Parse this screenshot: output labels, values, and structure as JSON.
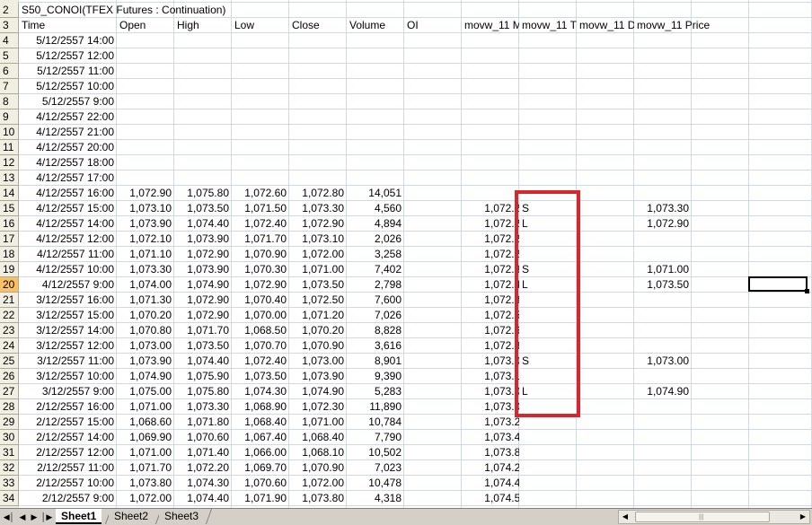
{
  "sheet": {
    "title_row_num": "2",
    "title": "S50_CONOI(TFEX Futures : Continuation)",
    "header_row_num": "3",
    "headers": [
      "Time",
      "Open",
      "High",
      "Low",
      "Close",
      "Volume",
      "OI",
      "movw_11 M",
      "movw_11 T",
      "movw_11 D",
      "movw_11 Price"
    ],
    "active_row": "20",
    "rows": [
      {
        "n": "4",
        "time": "5/12/2557 14:00",
        "open": "",
        "high": "",
        "low": "",
        "close": "",
        "volume": "",
        "mov": "",
        "sig": "",
        "price": ""
      },
      {
        "n": "5",
        "time": "5/12/2557 12:00",
        "open": "",
        "high": "",
        "low": "",
        "close": "",
        "volume": "",
        "mov": "",
        "sig": "",
        "price": ""
      },
      {
        "n": "6",
        "time": "5/12/2557 11:00",
        "open": "",
        "high": "",
        "low": "",
        "close": "",
        "volume": "",
        "mov": "",
        "sig": "",
        "price": ""
      },
      {
        "n": "7",
        "time": "5/12/2557 10:00",
        "open": "",
        "high": "",
        "low": "",
        "close": "",
        "volume": "",
        "mov": "",
        "sig": "",
        "price": ""
      },
      {
        "n": "8",
        "time": "5/12/2557 9:00",
        "open": "",
        "high": "",
        "low": "",
        "close": "",
        "volume": "",
        "mov": "",
        "sig": "",
        "price": ""
      },
      {
        "n": "9",
        "time": "4/12/2557 22:00",
        "open": "",
        "high": "",
        "low": "",
        "close": "",
        "volume": "",
        "mov": "",
        "sig": "",
        "price": ""
      },
      {
        "n": "10",
        "time": "4/12/2557 21:00",
        "open": "",
        "high": "",
        "low": "",
        "close": "",
        "volume": "",
        "mov": "",
        "sig": "",
        "price": ""
      },
      {
        "n": "11",
        "time": "4/12/2557 20:00",
        "open": "",
        "high": "",
        "low": "",
        "close": "",
        "volume": "",
        "mov": "",
        "sig": "",
        "price": ""
      },
      {
        "n": "12",
        "time": "4/12/2557 18:00",
        "open": "",
        "high": "",
        "low": "",
        "close": "",
        "volume": "",
        "mov": "",
        "sig": "",
        "price": ""
      },
      {
        "n": "13",
        "time": "4/12/2557 17:00",
        "open": "",
        "high": "",
        "low": "",
        "close": "",
        "volume": "",
        "mov": "",
        "sig": "",
        "price": ""
      },
      {
        "n": "14",
        "time": "4/12/2557 16:00",
        "open": "1,072.90",
        "high": "1,075.80",
        "low": "1,072.60",
        "close": "1,072.80",
        "volume": "14,051",
        "mov": "",
        "sig": "",
        "price": ""
      },
      {
        "n": "15",
        "time": "4/12/2557 15:00",
        "open": "1,073.10",
        "high": "1,073.50",
        "low": "1,071.50",
        "close": "1,073.30",
        "volume": "4,560",
        "mov": "1,072.24",
        "sig": "S",
        "price": "1,073.30"
      },
      {
        "n": "16",
        "time": "4/12/2557 14:00",
        "open": "1,073.90",
        "high": "1,074.40",
        "low": "1,072.40",
        "close": "1,072.90",
        "volume": "4,894",
        "mov": "1,072.24",
        "sig": "L",
        "price": "1,072.90"
      },
      {
        "n": "17",
        "time": "4/12/2557 12:00",
        "open": "1,072.10",
        "high": "1,073.90",
        "low": "1,071.70",
        "close": "1,073.10",
        "volume": "2,026",
        "mov": "1,072.22",
        "sig": "",
        "price": ""
      },
      {
        "n": "18",
        "time": "4/12/2557 11:00",
        "open": "1,071.10",
        "high": "1,072.90",
        "low": "1,070.90",
        "close": "1,072.00",
        "volume": "3,258",
        "mov": "1,072.23",
        "sig": "",
        "price": ""
      },
      {
        "n": "19",
        "time": "4/12/2557 10:00",
        "open": "1,073.30",
        "high": "1,073.90",
        "low": "1,070.30",
        "close": "1,071.00",
        "volume": "7,402",
        "mov": "1,072.31",
        "sig": "S",
        "price": "1,071.00"
      },
      {
        "n": "20",
        "time": "4/12/2557 9:00",
        "open": "1,074.00",
        "high": "1,074.90",
        "low": "1,072.90",
        "close": "1,073.50",
        "volume": "2,798",
        "mov": "1,072.41",
        "sig": "L",
        "price": "1,073.50"
      },
      {
        "n": "21",
        "time": "3/12/2557 16:00",
        "open": "1,071.30",
        "high": "1,072.90",
        "low": "1,070.40",
        "close": "1,072.50",
        "volume": "7,600",
        "mov": "1,072.39",
        "sig": "",
        "price": ""
      },
      {
        "n": "22",
        "time": "3/12/2557 15:00",
        "open": "1,070.20",
        "high": "1,072.90",
        "low": "1,070.00",
        "close": "1,071.20",
        "volume": "7,026",
        "mov": "1,072.50",
        "sig": "",
        "price": ""
      },
      {
        "n": "23",
        "time": "3/12/2557 14:00",
        "open": "1,070.80",
        "high": "1,071.70",
        "low": "1,068.50",
        "close": "1,070.20",
        "volume": "8,828",
        "mov": "1,072.60",
        "sig": "",
        "price": ""
      },
      {
        "n": "24",
        "time": "3/12/2557 12:00",
        "open": "1,073.00",
        "high": "1,073.50",
        "low": "1,070.70",
        "close": "1,070.90",
        "volume": "3,616",
        "mov": "1,072.85",
        "sig": "",
        "price": ""
      },
      {
        "n": "25",
        "time": "3/12/2557 11:00",
        "open": "1,073.90",
        "high": "1,074.40",
        "low": "1,072.40",
        "close": "1,073.00",
        "volume": "8,901",
        "mov": "1,073.04",
        "sig": "S",
        "price": "1,073.00"
      },
      {
        "n": "26",
        "time": "3/12/2557 10:00",
        "open": "1,074.90",
        "high": "1,075.90",
        "low": "1,073.50",
        "close": "1,073.90",
        "volume": "9,390",
        "mov": "1,073.10",
        "sig": "",
        "price": ""
      },
      {
        "n": "27",
        "time": "3/12/2557 9:00",
        "open": "1,075.00",
        "high": "1,075.80",
        "low": "1,074.30",
        "close": "1,074.90",
        "volume": "5,283",
        "mov": "1,073.09",
        "sig": "L",
        "price": "1,074.90"
      },
      {
        "n": "28",
        "time": "2/12/2557 16:00",
        "open": "1,071.00",
        "high": "1,073.30",
        "low": "1,068.90",
        "close": "1,072.30",
        "volume": "11,890",
        "mov": "1,073.05",
        "sig": "",
        "price": ""
      },
      {
        "n": "29",
        "time": "2/12/2557 15:00",
        "open": "1,068.60",
        "high": "1,071.80",
        "low": "1,068.40",
        "close": "1,071.00",
        "volume": "10,784",
        "mov": "1,073.22",
        "sig": "",
        "price": ""
      },
      {
        "n": "30",
        "time": "2/12/2557 14:00",
        "open": "1,069.90",
        "high": "1,070.60",
        "low": "1,067.40",
        "close": "1,068.40",
        "volume": "7,790",
        "mov": "1,073.48",
        "sig": "",
        "price": ""
      },
      {
        "n": "31",
        "time": "2/12/2557 12:00",
        "open": "1,071.00",
        "high": "1,071.40",
        "low": "1,066.00",
        "close": "1,068.10",
        "volume": "10,502",
        "mov": "1,073.84",
        "sig": "",
        "price": ""
      },
      {
        "n": "32",
        "time": "2/12/2557 11:00",
        "open": "1,071.70",
        "high": "1,072.20",
        "low": "1,069.70",
        "close": "1,070.90",
        "volume": "7,023",
        "mov": "1,074.22",
        "sig": "",
        "price": ""
      },
      {
        "n": "33",
        "time": "2/12/2557 10:00",
        "open": "1,073.80",
        "high": "1,074.30",
        "low": "1,070.60",
        "close": "1,072.00",
        "volume": "10,478",
        "mov": "1,074.46",
        "sig": "",
        "price": ""
      },
      {
        "n": "34",
        "time": "2/12/2557 9:00",
        "open": "1,072.00",
        "high": "1,074.40",
        "low": "1,071.90",
        "close": "1,073.80",
        "volume": "4,318",
        "mov": "1,074.59",
        "sig": "",
        "price": ""
      }
    ]
  },
  "tabs": [
    "Sheet1",
    "Sheet2",
    "Sheet3"
  ],
  "active_tab": "Sheet1",
  "highlight_color": "#d8262f"
}
